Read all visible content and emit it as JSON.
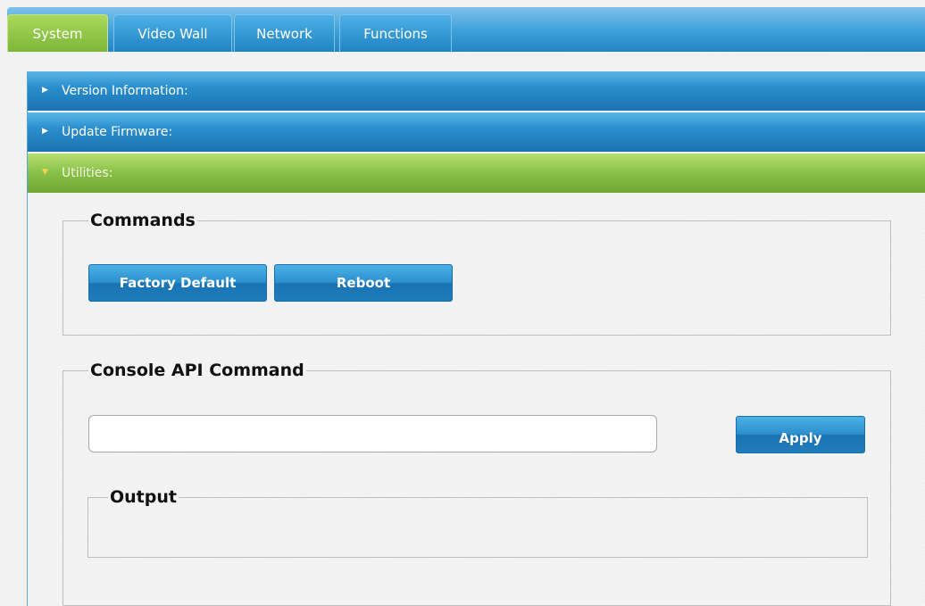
{
  "tabs": [
    {
      "label": "System",
      "active": true
    },
    {
      "label": "Video Wall",
      "active": false
    },
    {
      "label": "Network",
      "active": false
    },
    {
      "label": "Functions",
      "active": false
    }
  ],
  "sections": [
    {
      "label": "Version Information:",
      "expanded": false
    },
    {
      "label": "Update Firmware:",
      "expanded": false
    },
    {
      "label": "Utilities:",
      "expanded": true
    }
  ],
  "commands": {
    "legend": "Commands",
    "factory_default_label": "Factory Default",
    "reboot_label": "Reboot"
  },
  "console": {
    "legend": "Console API Command",
    "input_value": "",
    "input_placeholder": "",
    "apply_label": "Apply",
    "output_legend": "Output",
    "output_text": ""
  },
  "colors": {
    "active_tab": "#8cc34a",
    "tab_blue": "#2b8fcd",
    "accent_blue": "#1a72b1"
  }
}
